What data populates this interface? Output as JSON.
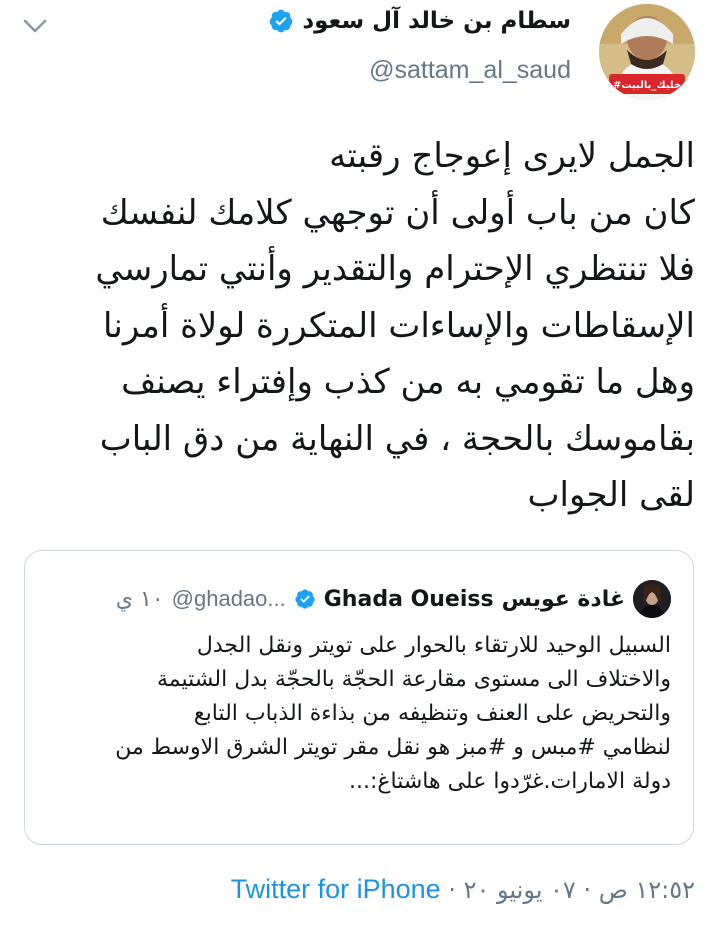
{
  "author": {
    "display_name": "سطام بن خالد آل سعود",
    "handle": "@sattam_al_saud",
    "verified": true,
    "avatar_banner_text": "#خليك_بالبيت"
  },
  "tweet": {
    "lines": [
      "الجمل لايرى إعوجاج رقبته",
      "كان من باب أولى أن توجهي كلامك لنفسك",
      "فلا تنتظري الإحترام والتقدير وأنتي تمارسي",
      "الإسقاطات والإساءات المتكررة لولاة أمرنا",
      "وهل ما تقومي به من كذب وإفتراء يصنف",
      "بقاموسك بالحجة ، في النهاية من دق الباب",
      "لقى الجواب"
    ]
  },
  "quoted": {
    "display_name_ar": "غادة عويس",
    "display_name_en": "Ghada Oueiss",
    "handle": "@ghadao...",
    "time": "١٠ ي",
    "verified": true,
    "lines": [
      "السبيل الوحيد للارتقاء بالحوار على تويتر ونقل الجدل",
      "والاختلاف الى مستوى مقارعة الحجّة بالحجّة بدل الشتيمة",
      "والتحريض على العنف وتنظيفه من بذاءة الذباب التابع",
      "لنظامي #مبس و #مبز هو نقل مقر تويتر الشرق الاوسط من",
      "دولة الامارات.غرّدوا على هاشتاغ:..."
    ]
  },
  "meta": {
    "timestamp": "١٢:٥٢ ص · ٠٧ يونيو ٢٠",
    "source": "Twitter for iPhone"
  },
  "colors": {
    "text": "#14171a",
    "secondary": "#657786",
    "link": "#1b95e0",
    "verified": "#1da1f2",
    "border": "#ccd6dd"
  },
  "icons": {
    "menu": "chevron-down-icon",
    "verified": "verified-badge-icon"
  }
}
